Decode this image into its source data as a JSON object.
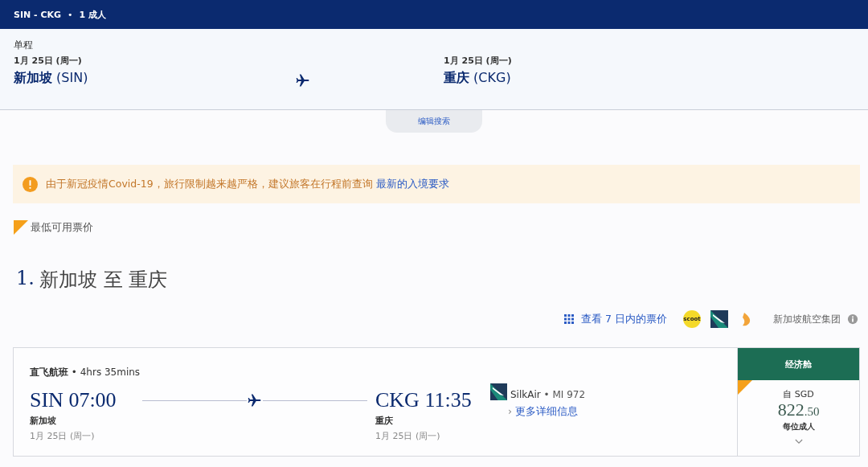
{
  "header": {
    "route": "SIN - CKG",
    "separator": "•",
    "passengers": "1 成人"
  },
  "search": {
    "trip_type": "单程",
    "origin": {
      "date": "1月 25日 (周一)",
      "city": "新加坡",
      "code": "(SIN)"
    },
    "destination": {
      "date": "1月 25日 (周一)",
      "city": "重庆",
      "code": "(CKG)"
    },
    "edit_button": "编辑搜索"
  },
  "alert": {
    "text": "由于新冠疫情Covid-19，旅行限制越来越严格，建议旅客在行程前查询",
    "link": "最新的入境要求"
  },
  "legend": {
    "label": "最低可用票价"
  },
  "section_title": {
    "number": "1.",
    "text": "新加坡 至 重庆"
  },
  "tools": {
    "calendar_link": "查看 7 日内的票价",
    "scoot_logo": "scoot",
    "group_label": "新加坡航空集团"
  },
  "flights": [
    {
      "type": "直飞航班",
      "separator": "•",
      "duration": "4hrs 35mins",
      "depart": {
        "code": "SIN",
        "time": "07:00",
        "city": "新加坡",
        "date": "1月 25日 (周一)"
      },
      "arrive": {
        "code": "CKG",
        "time": "11:35",
        "city": "重庆",
        "date": "1月 25日 (周一)"
      },
      "airline": "SilkAir",
      "airline_separator": "•",
      "flight_no": "MI 972",
      "details_chevron": "›",
      "details_link": "更多详细信息",
      "fare": {
        "cabin": "经济舱",
        "lowest": true,
        "from": "自 SGD",
        "price": "822",
        "price_decimal": ".50",
        "per": "每位成人"
      }
    }
  ]
}
